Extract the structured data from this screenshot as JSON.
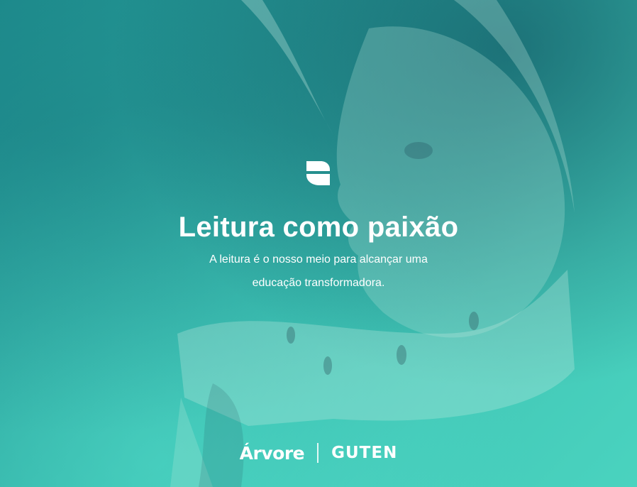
{
  "hero": {
    "title": "Leitura como paixão",
    "subtitle_lines": [
      "A leitura é o nosso meio para alcançar uma",
      "educação transformadora."
    ]
  },
  "partners": {
    "arvore": "Árvore",
    "guten": "GUTEN"
  },
  "icons": {
    "brand_mark": "book-mark-icon"
  },
  "colors": {
    "overlay_start": "#1f8f8f",
    "overlay_end": "#4ad3bf",
    "text": "#ffffff"
  }
}
